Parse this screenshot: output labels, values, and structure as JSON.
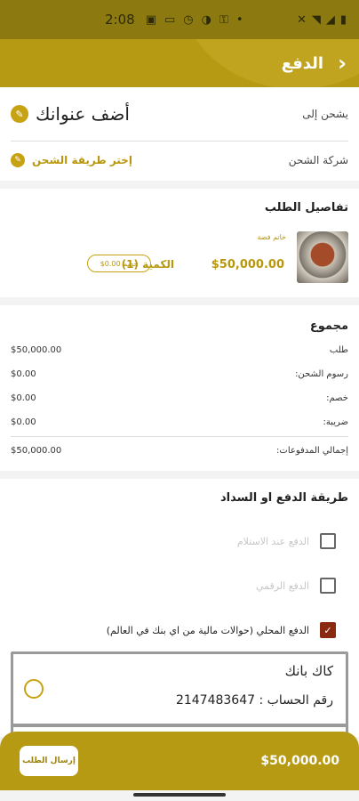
{
  "status_bar": {
    "time": "2:08",
    "icons": [
      "calendar-icon",
      "screen-icon",
      "alarm-icon",
      "globe-icon",
      "key-icon",
      "dot"
    ],
    "right_icons": [
      "bluetooth-off-icon",
      "wifi-icon",
      "signal-icon",
      "battery-icon"
    ]
  },
  "app_bar": {
    "title": "الدفع",
    "back_icon": "chevron-right-icon"
  },
  "address": {
    "label": "يشحن إلى",
    "value": "أضف عنوانك"
  },
  "shipping": {
    "label": "شركة الشحن",
    "value": "إختر طريقة الشحن"
  },
  "order": {
    "title": "تفاصيل الطلب",
    "product": {
      "tag": "خاتم فضة",
      "price": "$50,000.00",
      "quantity": "الكمية (1)",
      "discount": "خصم 0.00$"
    }
  },
  "totals": {
    "title": "مجموع",
    "rows": [
      {
        "label": "طلب",
        "value": "$50,000.00"
      },
      {
        "label": "رسوم الشحن:",
        "value": "$0.00"
      },
      {
        "label": "خصم:",
        "value": "$0.00"
      },
      {
        "label": "ضريبة:",
        "value": "$0.00"
      }
    ],
    "grand": {
      "label": "إجمالي المدفوعات:",
      "value": "$50,000.00"
    }
  },
  "payment": {
    "title": "طريقة الدفع او السداد",
    "options": [
      {
        "label": "الدفع عند الاستلام",
        "checked": false,
        "disabled": true
      },
      {
        "label": "الدفع الرقمي",
        "checked": false,
        "disabled": true
      },
      {
        "label": "الدفع المحلي (حوالات مالية من اي بنك في العالم)",
        "checked": true,
        "disabled": false
      }
    ],
    "bank": {
      "name": "كاك بانك",
      "account": "رقم الحساب : 2147483647"
    }
  },
  "bottom": {
    "submit_label": "إرسال الطلب",
    "total": "$50,000.00"
  },
  "colors": {
    "brand": "#b79a14",
    "accent": "#c7a314",
    "check": "#8a2a0f"
  }
}
